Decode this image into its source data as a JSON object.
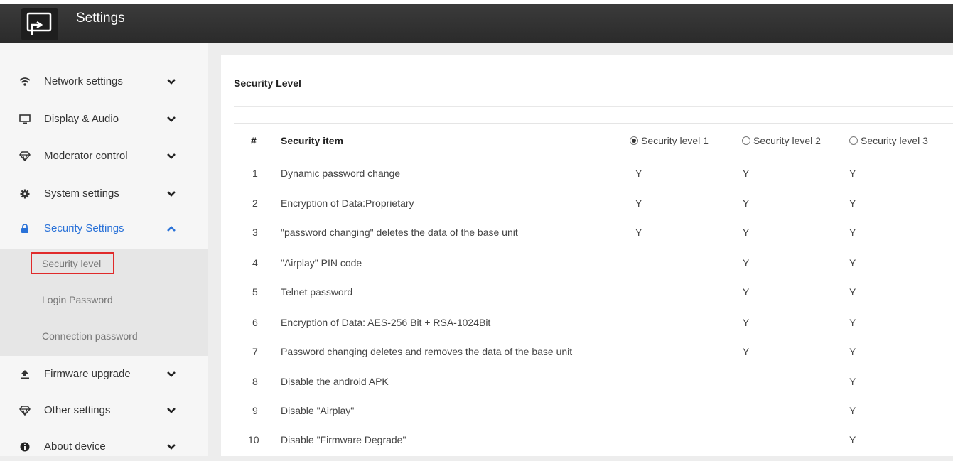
{
  "header": {
    "title": "Settings",
    "logo_icon": "screen-mirror-icon"
  },
  "sidebar": {
    "items": [
      {
        "label": "Network settings",
        "icon": "wifi-icon",
        "chevron": "down"
      },
      {
        "label": "Display & Audio",
        "icon": "monitor-icon",
        "chevron": "down"
      },
      {
        "label": "Moderator control",
        "icon": "diamond-icon",
        "chevron": "down"
      },
      {
        "label": "System settings",
        "icon": "gear-icon",
        "chevron": "down"
      },
      {
        "label": "Security Settings",
        "icon": "lock-icon",
        "chevron": "up"
      },
      {
        "label": "Firmware upgrade",
        "icon": "upload-icon",
        "chevron": "down"
      },
      {
        "label": "Other settings",
        "icon": "diamond-icon",
        "chevron": "down"
      },
      {
        "label": "About device",
        "icon": "info-icon",
        "chevron": "down"
      }
    ],
    "security_sub": [
      "Security level",
      "Login Password",
      "Connection password"
    ],
    "active_color": "#2a72d8"
  },
  "main": {
    "section_title": "Security Level",
    "table": {
      "col_num": "#",
      "col_item": "Security item",
      "levels": [
        "Security level 1",
        "Security level 2",
        "Security level 3"
      ],
      "selected_level": "Security level 1",
      "rows": [
        {
          "n": "1",
          "item": "Dynamic password change",
          "l1": "Y",
          "l2": "Y",
          "l3": "Y"
        },
        {
          "n": "2",
          "item": "Encryption of Data:Proprietary",
          "l1": "Y",
          "l2": "Y",
          "l3": "Y"
        },
        {
          "n": "3",
          "item": "\"password changing\" deletes the data of the base unit",
          "l1": "Y",
          "l2": "Y",
          "l3": "Y"
        },
        {
          "n": "4",
          "item": "\"Airplay\" PIN code",
          "l1": "",
          "l2": "Y",
          "l3": "Y"
        },
        {
          "n": "5",
          "item": "Telnet password",
          "l1": "",
          "l2": "Y",
          "l3": "Y"
        },
        {
          "n": "6",
          "item": "Encryption of Data: AES-256 Bit + RSA-1024Bit",
          "l1": "",
          "l2": "Y",
          "l3": "Y"
        },
        {
          "n": "7",
          "item": "Password changing deletes and removes the data of the base unit",
          "l1": "",
          "l2": "Y",
          "l3": "Y"
        },
        {
          "n": "8",
          "item": "Disable the android APK",
          "l1": "",
          "l2": "",
          "l3": "Y"
        },
        {
          "n": "9",
          "item": "Disable \"Airplay\"",
          "l1": "",
          "l2": "",
          "l3": "Y"
        },
        {
          "n": "10",
          "item": "Disable \"Firmware Degrade\"",
          "l1": "",
          "l2": "",
          "l3": "Y"
        }
      ]
    }
  }
}
